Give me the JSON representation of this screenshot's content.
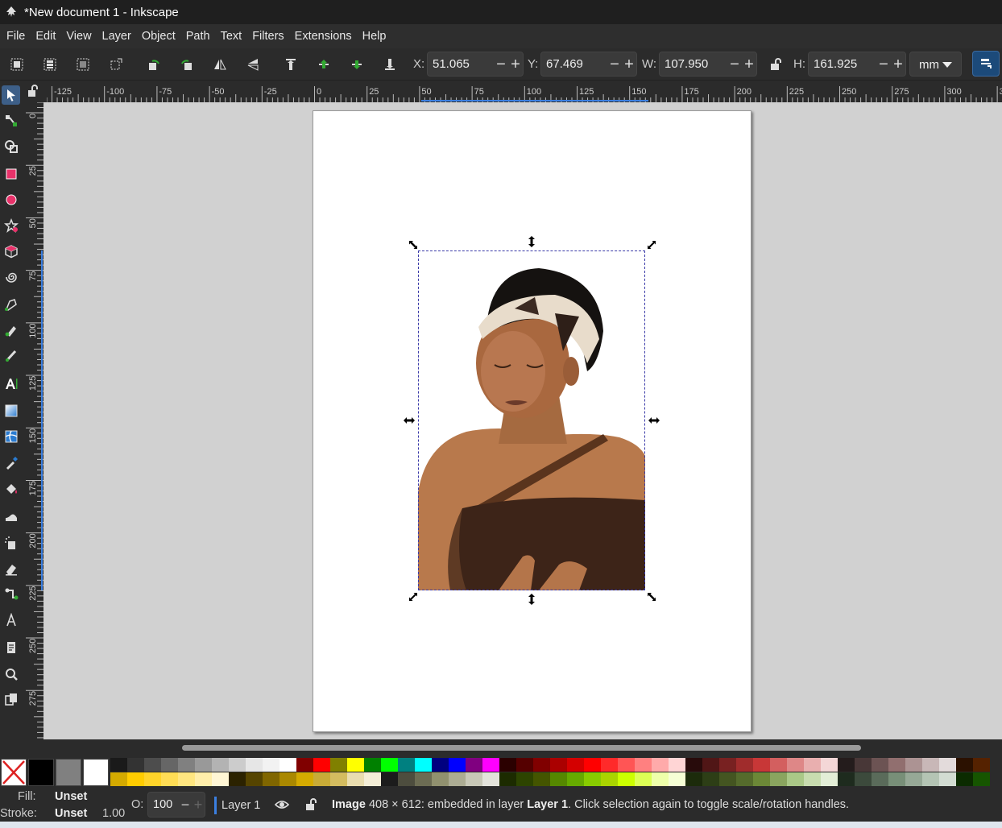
{
  "window": {
    "title": "*New document 1 - Inkscape"
  },
  "menu": [
    "File",
    "Edit",
    "View",
    "Layer",
    "Object",
    "Path",
    "Text",
    "Filters",
    "Extensions",
    "Help"
  ],
  "toolbar": {
    "x_label": "X:",
    "x_value": "51.065",
    "y_label": "Y:",
    "y_value": "67.469",
    "w_label": "W:",
    "w_value": "107.950",
    "h_label": "H:",
    "h_value": "161.925",
    "unit": "mm",
    "minus": "−",
    "plus": "+"
  },
  "rulers": {
    "h_labels": [
      "-125",
      "-100",
      "-75",
      "-50",
      "-25",
      "0",
      "25",
      "50",
      "75",
      "100",
      "125",
      "150",
      "175",
      "200",
      "225",
      "250",
      "275",
      "300",
      "32"
    ],
    "v_labels": [
      "0",
      "25",
      "50",
      "75",
      "100",
      "125",
      "150",
      "175",
      "200",
      "225",
      "250",
      "275"
    ]
  },
  "canvas": {
    "image_description": "woman with headband"
  },
  "status": {
    "fill_label": "Fill:",
    "fill_value": "Unset",
    "stroke_label": "Stroke:",
    "stroke_value": "Unset",
    "stroke_width": "1.00",
    "opacity_label": "O:",
    "opacity_value": "100",
    "layer_name": "Layer 1",
    "message_bold": "Image",
    "message_mid": " 408 × 612: embedded in layer ",
    "message_layer": "Layer 1",
    "message_tail": ". Click selection again to toggle scale/rotation handles."
  },
  "palette": {
    "row1": [
      "#1a1a1a",
      "#333333",
      "#4d4d4d",
      "#666666",
      "#808080",
      "#999999",
      "#b3b3b3",
      "#cccccc",
      "#e6e6e6",
      "#f2f2f2",
      "#ffffff",
      "#800000",
      "#ff0000",
      "#808000",
      "#ffff00",
      "#008000",
      "#00ff00",
      "#008080",
      "#00ffff",
      "#000080",
      "#0000ff",
      "#800080",
      "#ff00ff",
      "#2b0000",
      "#550000",
      "#800000",
      "#aa0000",
      "#d40000",
      "#ff0000",
      "#ff2a2a",
      "#ff5555",
      "#ff8080",
      "#ffaaaa",
      "#ffd5d5",
      "#280b0b",
      "#501616",
      "#782121",
      "#a02c2c",
      "#c83737",
      "#d35f5f",
      "#de8787",
      "#e9afaf",
      "#f4d7d7",
      "#241c1c",
      "#483737",
      "#6c5353",
      "#916f6f",
      "#ac9393",
      "#c8b7b7",
      "#e3dbdb",
      "#2b1100",
      "#552200"
    ],
    "row2": [
      "#d4aa00",
      "#ffcc00",
      "#ffd42a",
      "#ffdd55",
      "#ffe680",
      "#ffeeaa",
      "#fff6d5",
      "#2b2200",
      "#554400",
      "#806600",
      "#aa8800",
      "#d4aa00",
      "#c8ab37",
      "#d3bc5f",
      "#e9ddaf",
      "#f4eed7",
      "#1c1c1c",
      "#4d4d3e",
      "#6c6c53",
      "#91916f",
      "#acac93",
      "#c8c8b7",
      "#e3e3db",
      "#1c2b00",
      "#2d4400",
      "#445500",
      "#558800",
      "#66aa00",
      "#88cc00",
      "#aad400",
      "#ccff00",
      "#ddff55",
      "#eeffaa",
      "#f6ffd5",
      "#1c2b0b",
      "#2d3e16",
      "#445521",
      "#556b2c",
      "#6c8837",
      "#8aa55f",
      "#aac887",
      "#c8dcaf",
      "#e3eed7",
      "#1e2b1e",
      "#3c4a3c",
      "#5a6b5a",
      "#788f78",
      "#96a896",
      "#b4c4b4",
      "#d2dcd2",
      "#0b2b00",
      "#165500"
    ],
    "fill_none_color": "#ffffff",
    "black": "#000000",
    "grey": "#808080",
    "white": "#ffffff"
  },
  "colors": {
    "accent": "#3b7fe0",
    "selection": "#3a3aa8"
  }
}
